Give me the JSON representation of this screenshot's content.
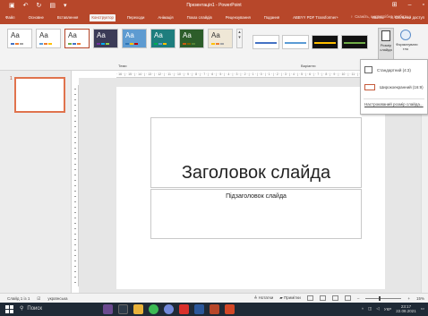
{
  "titlebar": {
    "document_title": "Презентація1 - PowerPoint",
    "icons": [
      "save-icon",
      "undo-icon",
      "redo-icon",
      "start-from-beginning-icon",
      "customize-qat-icon"
    ]
  },
  "tabs": [
    {
      "label": "Файл"
    },
    {
      "label": "Основне"
    },
    {
      "label": "Вставлення"
    },
    {
      "label": "Конструктор",
      "active": true
    },
    {
      "label": "Переходи"
    },
    {
      "label": "Анімація"
    },
    {
      "label": "Показ слайдів"
    },
    {
      "label": "Рецензування"
    },
    {
      "label": "Подання"
    },
    {
      "label": "ABBYY PDF Transformer+"
    }
  ],
  "tell_me": "Скажіть, що потрібно зробити",
  "account": {
    "sign_in": "Увійти",
    "share": "Спільний доступ"
  },
  "ribbon": {
    "themes_group_label": "Теми",
    "variants_group_label": "Варіанти",
    "slide_size_label_1": "Розмір",
    "slide_size_label_2": "слайда",
    "format_bg_label_1": "Форматувати",
    "format_bg_label_2": "тло",
    "theme_sample_text": "Аа"
  },
  "ruler_h_text": "· 16 · | · 15 · | · 14 · | · 13 · | · 12 · | · 11 · | · 10 · | · 9 · | · 8 · | · 7 · | · 6 · | · 5 · | · 4 · | · 3 · | · 2 · | · 1 · | · 0 · | · 1 · | · 2 · | · 3 · | · 4 · | · 5 · | · 6 · | · 7 · | · 8 · | · 9 · | · 10 · | · 11 · | · 12 ·",
  "slide_size_menu": {
    "standard": "Стандартний (4:3)",
    "widescreen": "Широкоекранний (16:9)",
    "custom": "Настроюваний розмір слайда..."
  },
  "thumbnail_number": "1",
  "slide": {
    "title": "Заголовок слайда",
    "subtitle": "Підзаголовок слайда"
  },
  "statusbar": {
    "slide_counter": "Слайд 1 із 1",
    "language": "українська",
    "notes": "Нотатки",
    "comments": "Примітки",
    "zoom": "15%"
  },
  "taskbar": {
    "search_placeholder": "Поиск",
    "tray_language": "УКР",
    "time": "23:17",
    "date": "22.08.2021"
  },
  "colors": {
    "accent": "#b7472a",
    "theme_stripes": [
      [
        "#4472c4",
        "#ed7d31",
        "#a5a5a5"
      ],
      [
        "#5b9bd5",
        "#ed7d31",
        "#ffc000"
      ],
      [
        "#70ad47",
        "#4472c4",
        "#ed7d31"
      ],
      [
        "#7030a0",
        "#00b0f0",
        "#92d050"
      ],
      [
        "#2e75b6",
        "#ffc000",
        "#c00000"
      ],
      [
        "#00b050",
        "#5b9bd5",
        "#ffc000"
      ],
      [
        "#c55a11",
        "#7f6000",
        "#548235"
      ],
      [
        "#ffc000",
        "#ed7d31",
        "#a5a5a5"
      ]
    ],
    "variant_stripes": [
      "#4472c4",
      "#5b9bd5",
      "#ffc000",
      "#70ad47"
    ]
  }
}
